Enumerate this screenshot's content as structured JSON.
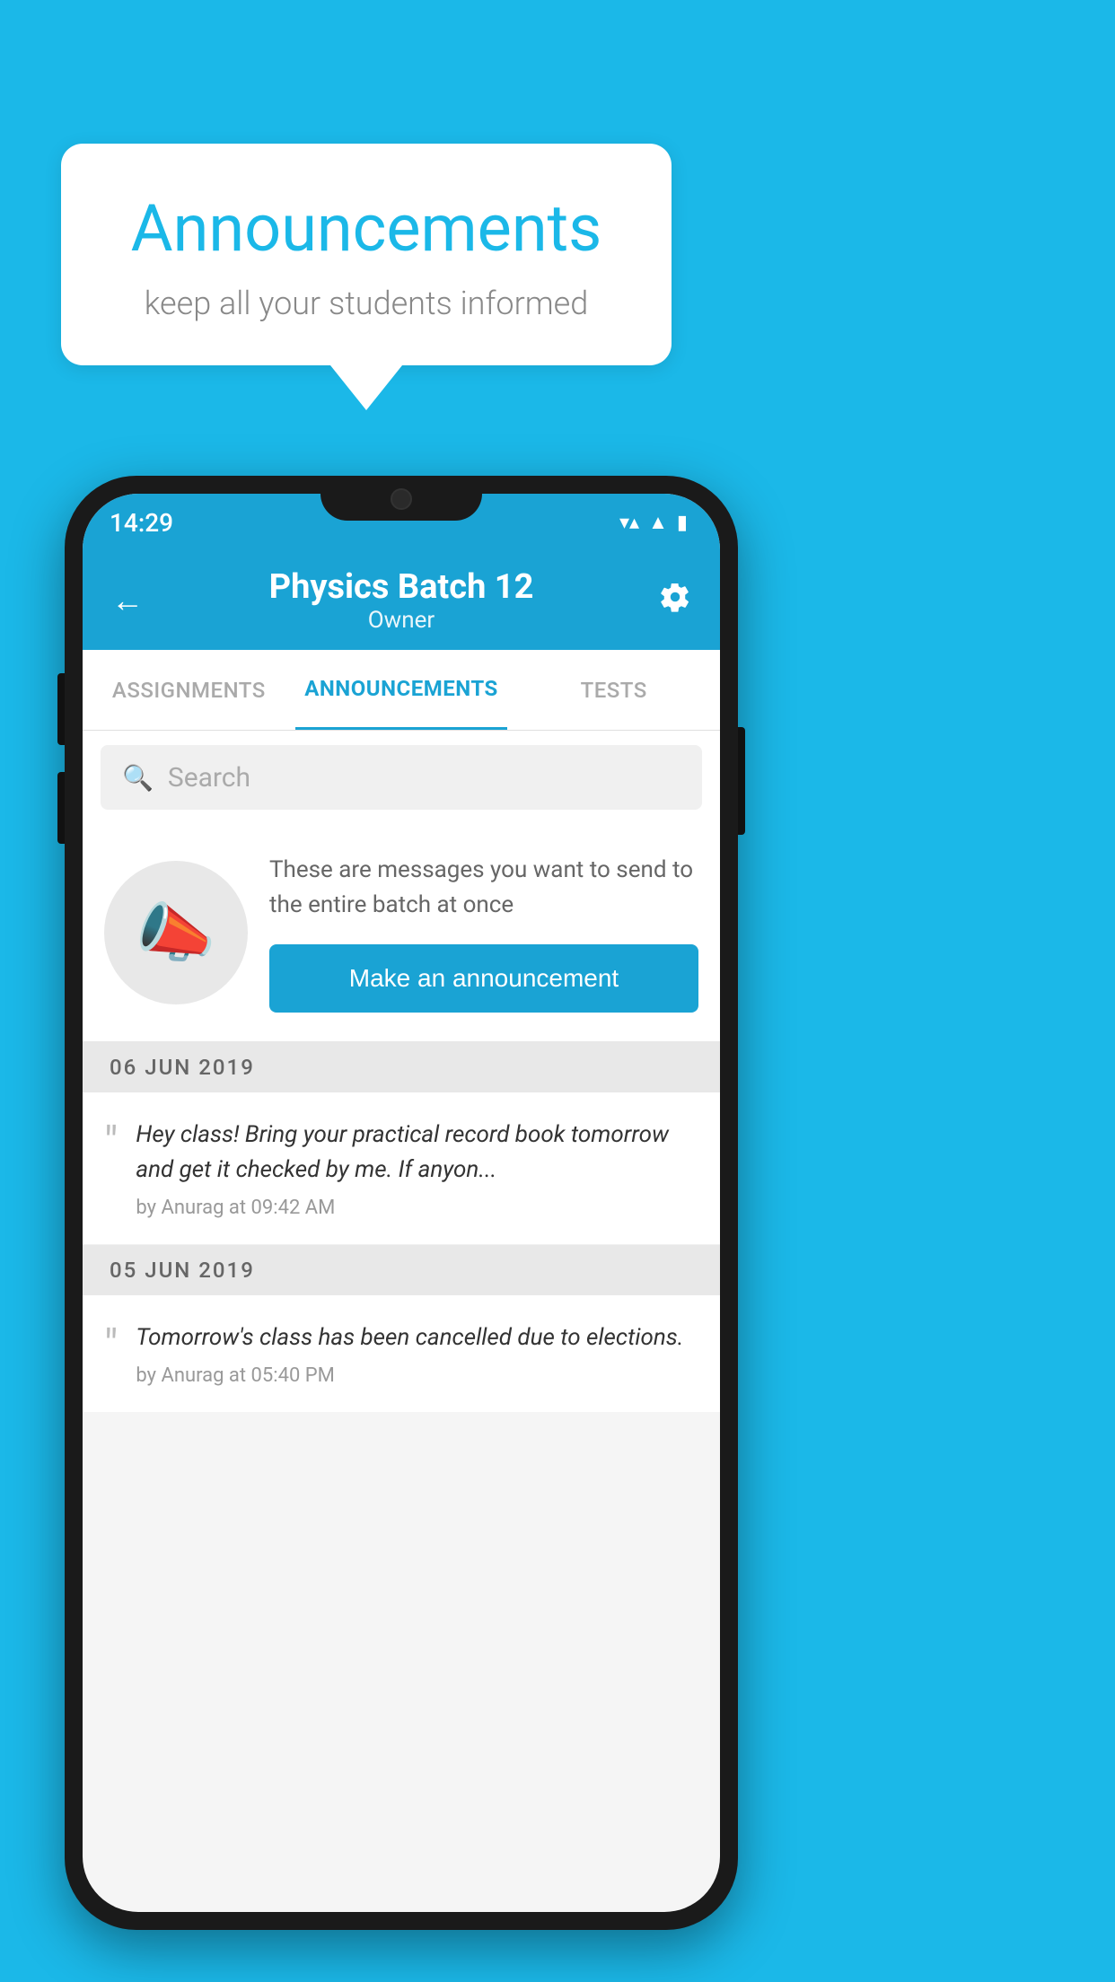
{
  "background_color": "#1bb8e8",
  "speech_bubble": {
    "title": "Announcements",
    "subtitle": "keep all your students informed"
  },
  "phone": {
    "status_bar": {
      "time": "14:29",
      "wifi": "▼",
      "signal": "▲",
      "battery": "▮"
    },
    "header": {
      "title": "Physics Batch 12",
      "subtitle": "Owner",
      "back_label": "←",
      "settings_label": "⚙"
    },
    "tabs": [
      {
        "label": "ASSIGNMENTS",
        "active": false
      },
      {
        "label": "ANNOUNCEMENTS",
        "active": true
      },
      {
        "label": "TESTS",
        "active": false
      },
      {
        "label": "...",
        "active": false
      }
    ],
    "search": {
      "placeholder": "Search"
    },
    "promo": {
      "description": "These are messages you want to send to the entire batch at once",
      "button_label": "Make an announcement"
    },
    "date_sections": [
      {
        "date": "06  JUN  2019",
        "announcements": [
          {
            "text": "Hey class! Bring your practical record book tomorrow and get it checked by me. If anyon...",
            "meta": "by Anurag at 09:42 AM"
          }
        ]
      },
      {
        "date": "05  JUN  2019",
        "announcements": [
          {
            "text": "Tomorrow's class has been cancelled due to elections.",
            "meta": "by Anurag at 05:40 PM"
          }
        ]
      }
    ]
  }
}
